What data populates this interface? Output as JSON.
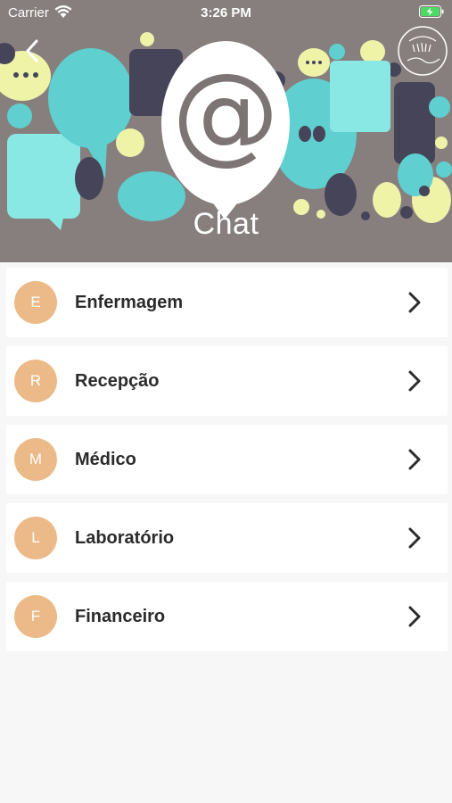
{
  "status_bar": {
    "carrier": "Carrier",
    "time": "3:26 PM"
  },
  "header": {
    "title": "Chat",
    "icon_glyph": "@",
    "background_color": "#877f7e"
  },
  "departments": [
    {
      "initial": "E",
      "label": "Enfermagem"
    },
    {
      "initial": "R",
      "label": "Recepção"
    },
    {
      "initial": "M",
      "label": "Médico"
    },
    {
      "initial": "L",
      "label": "Laboratório"
    },
    {
      "initial": "F",
      "label": "Financeiro"
    }
  ],
  "colors": {
    "avatar": "#ecba88",
    "row_background": "#ffffff",
    "page_background": "#f7f7f7",
    "bubble_teal": "#5fcfcf",
    "bubble_light": "#8ae8e4",
    "bubble_dark": "#464458",
    "bubble_yellow": "#eef3a8"
  },
  "icons": {
    "back": "chevron-left-icon",
    "row_arrow": "chevron-right-icon",
    "wifi": "wifi-icon",
    "battery": "battery-charging-icon"
  }
}
